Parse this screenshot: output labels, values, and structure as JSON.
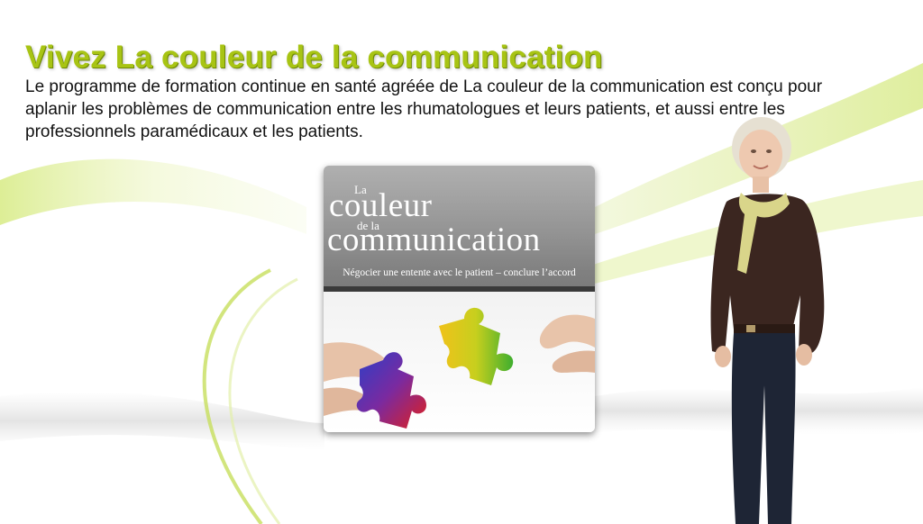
{
  "header": {
    "title": "Vivez La couleur de la communication",
    "intro": "Le programme de formation continue en santé agréée de La couleur de la communication est conçu pour aplanir les problèmes de communication entre les rhumatologues et leurs patients, et aussi entre les professionnels paramédicaux et les patients."
  },
  "cover": {
    "word_la": "La",
    "word_couleur": "couleur",
    "word_de_la": "de la",
    "word_communication": "communication",
    "tagline": "Négocier une entente avec le patient – conclure l’accord"
  },
  "colors": {
    "headline": "#a8c414",
    "swoosh": "#c8e06a"
  }
}
